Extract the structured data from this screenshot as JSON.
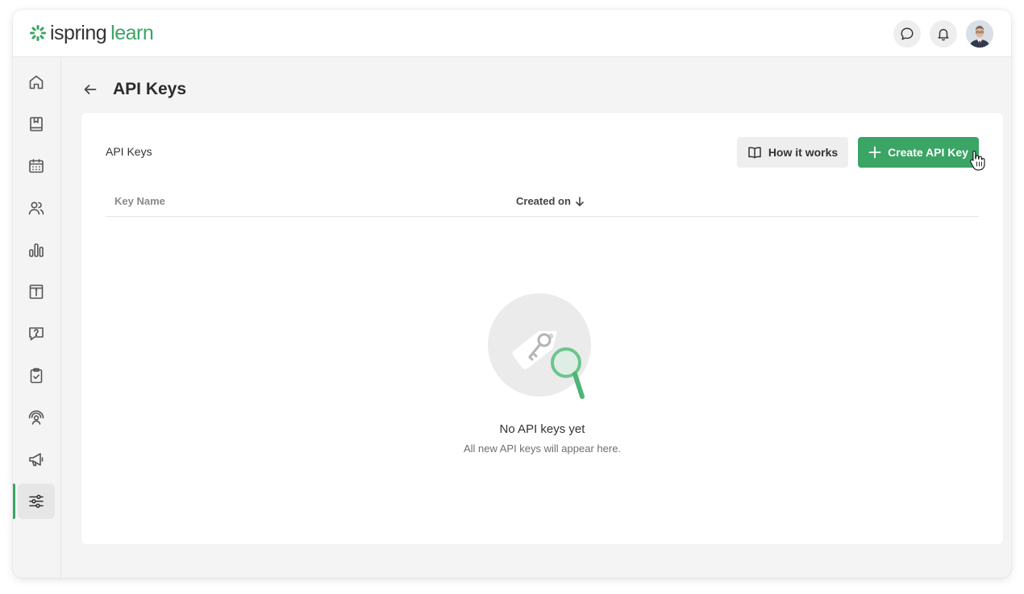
{
  "app": {
    "logo_word1": "ispring",
    "logo_word2": "learn",
    "brand_color": "#3aa565"
  },
  "topbar": {
    "icons": [
      "chat-icon",
      "bell-icon",
      "user-avatar"
    ]
  },
  "sidebar": {
    "items": [
      {
        "icon": "home-icon",
        "active": false
      },
      {
        "icon": "book-icon",
        "active": false
      },
      {
        "icon": "calendar-icon",
        "active": false
      },
      {
        "icon": "users-icon",
        "active": false
      },
      {
        "icon": "bar-chart-icon",
        "active": false
      },
      {
        "icon": "info-box-icon",
        "active": false
      },
      {
        "icon": "question-chat-icon",
        "active": false
      },
      {
        "icon": "clipboard-check-icon",
        "active": false
      },
      {
        "icon": "user-signal-icon",
        "active": false
      },
      {
        "icon": "megaphone-icon",
        "active": false
      },
      {
        "icon": "sliders-icon",
        "active": true
      }
    ]
  },
  "page": {
    "title": "API Keys"
  },
  "card": {
    "title": "API Keys",
    "how_it_works_label": "How it works",
    "create_label": "Create API Key"
  },
  "table": {
    "columns": [
      {
        "label": "Key Name"
      },
      {
        "label": "Created on",
        "sort": "desc"
      }
    ],
    "rows": []
  },
  "empty_state": {
    "title": "No API keys yet",
    "subtitle": "All new API keys will appear here."
  }
}
